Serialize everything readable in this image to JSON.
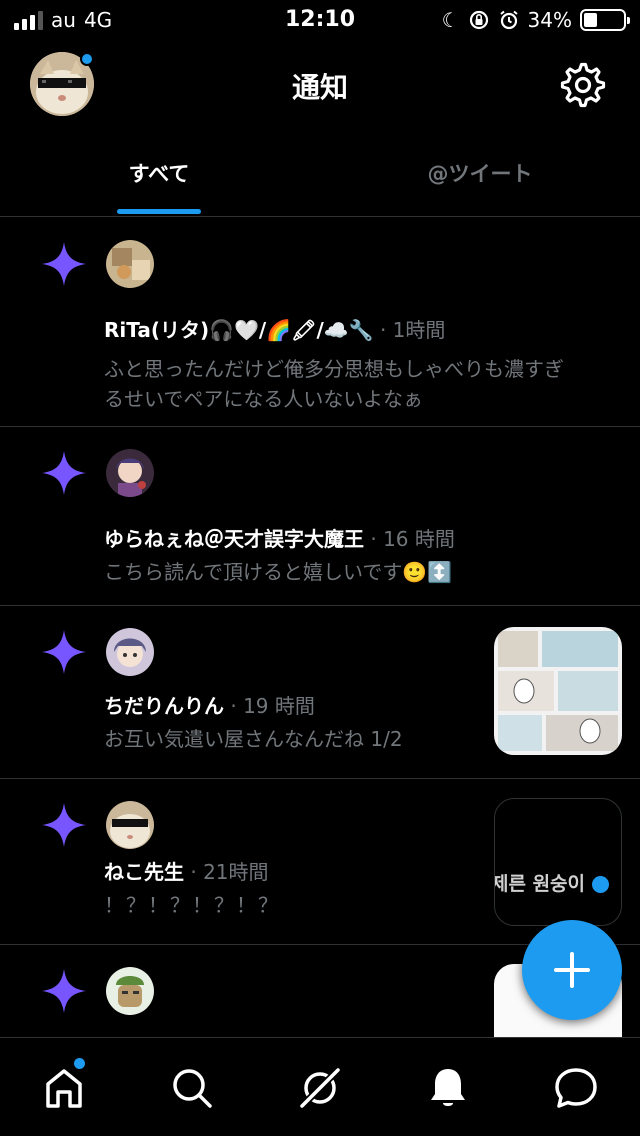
{
  "status_bar": {
    "carrier": "au",
    "network": "4G",
    "time": "12:10",
    "battery": "34%",
    "battery_level": 0.34,
    "icons": [
      "moon-icon",
      "orientation-lock-icon",
      "alarm-icon"
    ]
  },
  "header": {
    "title": "通知",
    "avatar_icon": "user-avatar",
    "settings_icon": "gear-icon"
  },
  "tabs": [
    {
      "label": "すべて",
      "active": true
    },
    {
      "label": "@ツイート",
      "active": false
    }
  ],
  "notifications": [
    {
      "name": "RiTa(リタ)🎧🤍/🌈🖍/☁️🔧",
      "time": "· 1時間",
      "text": [
        "ふと思ったんだけど俺多分思想もしゃべりも濃すぎ",
        "るせいでペアになる人いないよなぁ"
      ],
      "has_thumbnail": false
    },
    {
      "name": "ゆらねぇね＠天才誤字大魔王",
      "time": "· 16 時間",
      "text": [
        "こちら読んで頂けると嬉しいです🙂↕️"
      ],
      "has_thumbnail": false
    },
    {
      "name": "ちだりんりん",
      "time": "· 19 時間",
      "text": [
        "お互い気遣い屋さんなんだね 1/2"
      ],
      "has_thumbnail": true
    },
    {
      "name": "ねこ先生",
      "time": "· 21時間",
      "text": [
        "！？！？！？！？"
      ],
      "has_thumbnail": true,
      "thumbnail_text": "제른 원숭이"
    },
    {
      "name": "",
      "time": "",
      "text": [],
      "has_thumbnail": true
    }
  ],
  "fab": {
    "icon": "plus-icon"
  },
  "tab_bar": {
    "items": [
      "home-icon",
      "search-icon",
      "spaces-icon",
      "bell-icon",
      "message-icon"
    ],
    "home_has_dot": true
  },
  "colors": {
    "background": "#000000",
    "accent": "#1d9bf0",
    "spark": "#7856ff",
    "secondary_text": "#71767b",
    "divider": "#2f3336"
  }
}
